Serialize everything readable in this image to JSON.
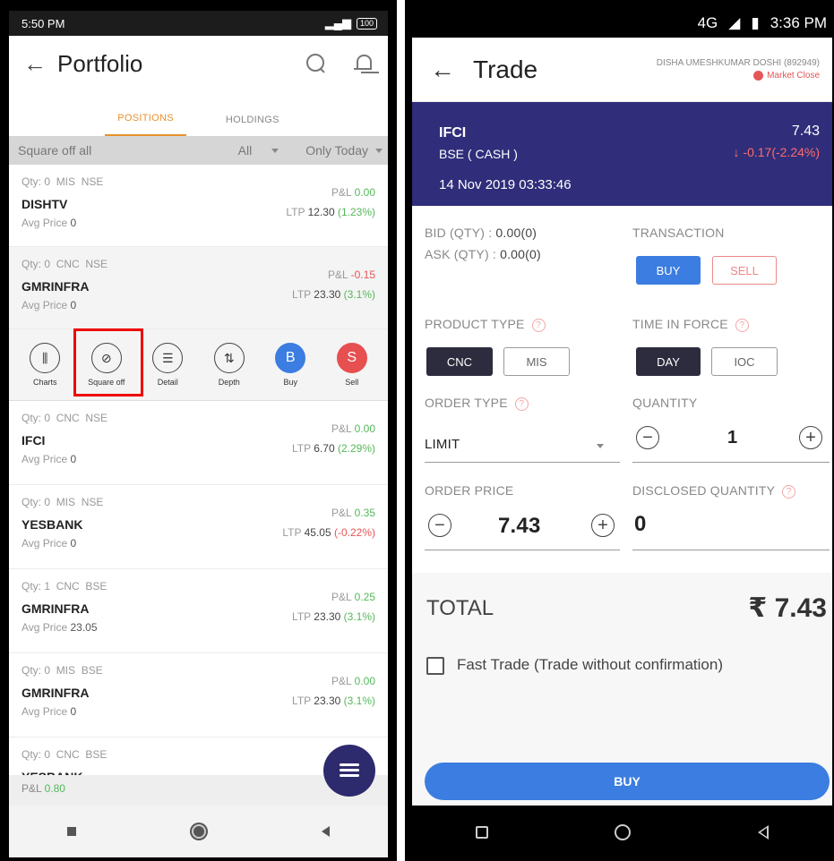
{
  "left": {
    "status": {
      "time": "5:50 PM",
      "battery": "100"
    },
    "header": {
      "back_glyph": "←",
      "title": "Portfolio"
    },
    "tabs": [
      {
        "label": "POSITIONS",
        "active": true
      },
      {
        "label": "HOLDINGS",
        "active": false
      }
    ],
    "filter": {
      "square_off_all": "Square off all",
      "exchange": "All",
      "period": "Only Today"
    },
    "positions": [
      {
        "qty": "Qty: 0",
        "product": "MIS",
        "exchange": "NSE",
        "symbol": "DISHTV",
        "avg_label": "Avg Price",
        "avg": "0",
        "pl_label": "P&L",
        "pl": "0.00",
        "ltp_label": "LTP",
        "ltp": "12.30",
        "chg": "(1.23%)"
      },
      {
        "qty": "Qty: 0",
        "product": "CNC",
        "exchange": "NSE",
        "symbol": "GMRINFRA",
        "avg_label": "Avg Price",
        "avg": "0",
        "pl_label": "P&L",
        "pl": "-0.15",
        "ltp_label": "LTP",
        "ltp": "23.30",
        "chg": "(3.1%)"
      },
      {
        "qty": "Qty: 0",
        "product": "CNC",
        "exchange": "NSE",
        "symbol": "IFCI",
        "avg_label": "Avg Price",
        "avg": "0",
        "pl_label": "P&L",
        "pl": "0.00",
        "ltp_label": "LTP",
        "ltp": "6.70",
        "chg": "(2.29%)"
      },
      {
        "qty": "Qty: 0",
        "product": "MIS",
        "exchange": "NSE",
        "symbol": "YESBANK",
        "avg_label": "Avg Price",
        "avg": "0",
        "pl_label": "P&L",
        "pl": "0.35",
        "ltp_label": "LTP",
        "ltp": "45.05",
        "chg": "(-0.22%)"
      },
      {
        "qty": "Qty: 1",
        "product": "CNC",
        "exchange": "BSE",
        "symbol": "GMRINFRA",
        "avg_label": "Avg Price",
        "avg": "23.05",
        "pl_label": "P&L",
        "pl": "0.25",
        "ltp_label": "LTP",
        "ltp": "23.30",
        "chg": "(3.1%)"
      },
      {
        "qty": "Qty: 0",
        "product": "MIS",
        "exchange": "BSE",
        "symbol": "GMRINFRA",
        "avg_label": "Avg Price",
        "avg": "0",
        "pl_label": "P&L",
        "pl": "0.00",
        "ltp_label": "LTP",
        "ltp": "23.30",
        "chg": "(3.1%)"
      },
      {
        "qty": "Qty: 0",
        "product": "CNC",
        "exchange": "BSE",
        "symbol": "YESBANK"
      }
    ],
    "actions": [
      {
        "label": "Charts",
        "glyph": "⫼"
      },
      {
        "label": "Square off",
        "glyph": "⊘"
      },
      {
        "label": "Detail",
        "glyph": "☰"
      },
      {
        "label": "Depth",
        "glyph": "⇅"
      },
      {
        "label": "Buy",
        "glyph": "B"
      },
      {
        "label": "Sell",
        "glyph": "S"
      }
    ],
    "bottom": {
      "pl_label": "P&L",
      "pl": "0.80"
    }
  },
  "right": {
    "status": {
      "network": "4G",
      "time": "3:36 PM"
    },
    "header": {
      "back_glyph": "←",
      "title": "Trade",
      "user": "DISHA UMESHKUMAR DOSHI (892949)",
      "market": "Market Close"
    },
    "instrument": {
      "symbol": "IFCI",
      "exchange": "BSE ( CASH )",
      "datetime": "14 Nov 2019  03:33:46",
      "price": "7.43",
      "change": "↓ -0.17(-2.24%)"
    },
    "form": {
      "bid_label": "BID (QTY) :",
      "bid": "0.00(0)",
      "ask_label": "ASK (QTY) :",
      "ask": "0.00(0)",
      "transaction_label": "TRANSACTION",
      "buy": "BUY",
      "sell": "SELL",
      "product_label": "PRODUCT TYPE",
      "cnc": "CNC",
      "mis": "MIS",
      "tif_label": "TIME IN FORCE",
      "day": "DAY",
      "ioc": "IOC",
      "order_type_label": "ORDER TYPE",
      "order_type": "LIMIT",
      "quantity_label": "QUANTITY",
      "quantity": "1",
      "order_price_label": "ORDER PRICE",
      "order_price": "7.43",
      "disclosed_label": "DISCLOSED QUANTITY",
      "disclosed": "0",
      "minus": "−",
      "plus": "+",
      "help": "?"
    },
    "total": {
      "label": "TOTAL",
      "value": "₹ 7.43"
    },
    "fast_trade": "Fast Trade (Trade without confirmation)",
    "buy_button": "BUY"
  }
}
